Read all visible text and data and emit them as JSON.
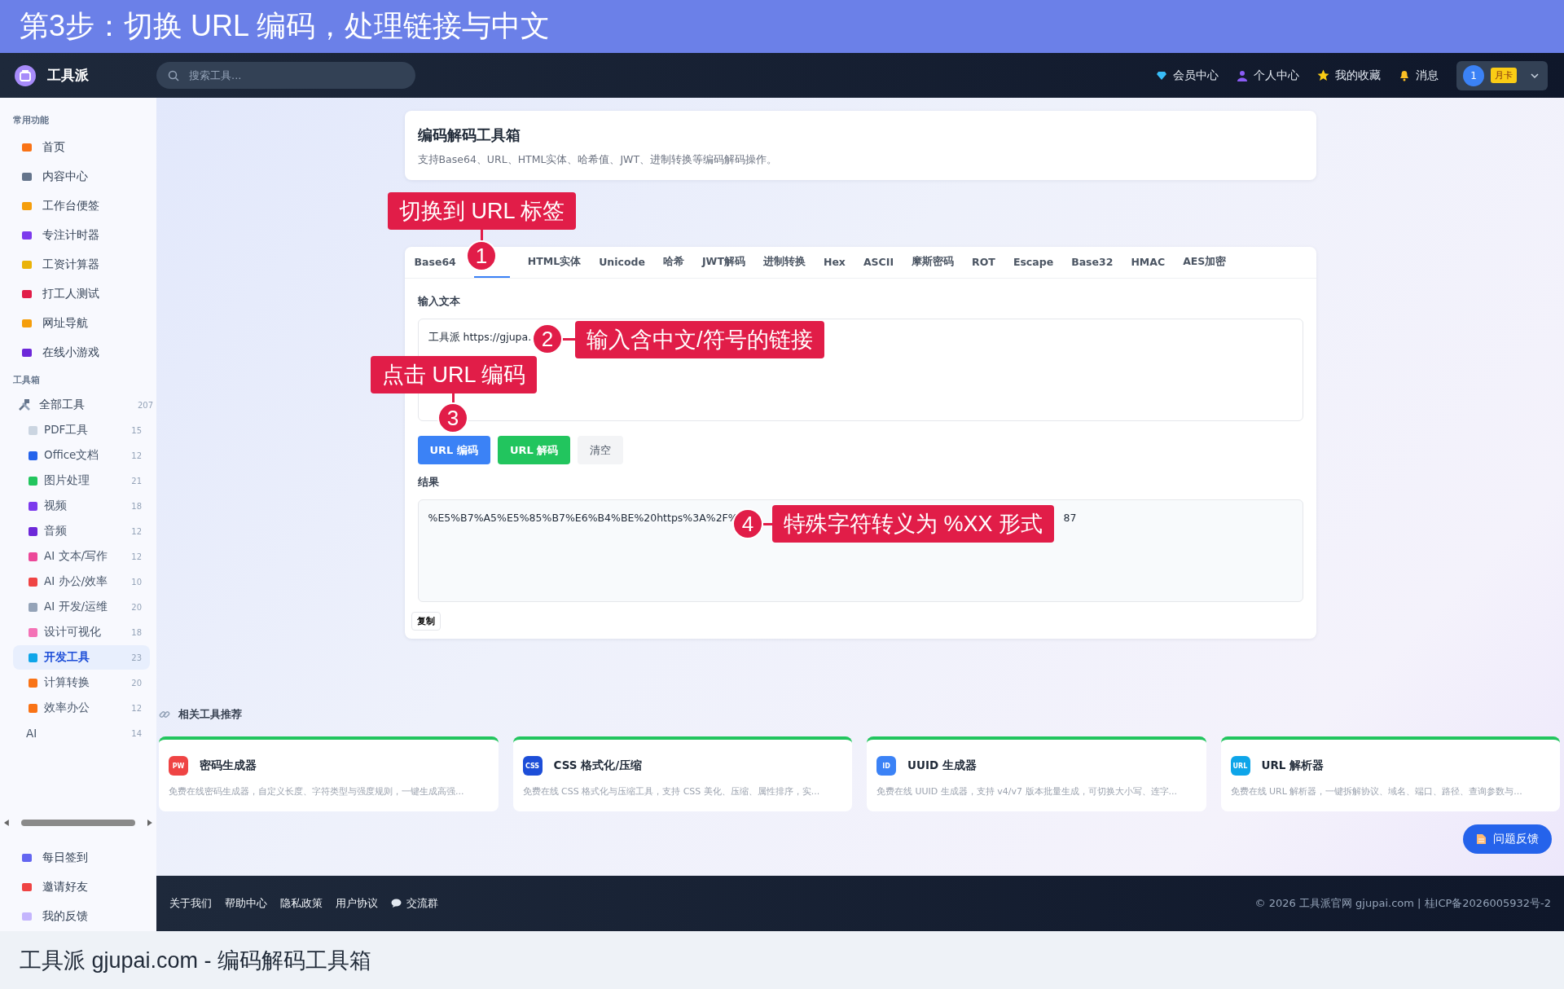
{
  "banner": {
    "title": "第3步：切换 URL 编码，处理链接与中文"
  },
  "header": {
    "logo": "工具派",
    "search": {
      "placeholder": "搜索工具..."
    },
    "nav": [
      {
        "label": "会员中心",
        "kind": "diamond"
      },
      {
        "label": "个人中心",
        "kind": "person"
      },
      {
        "label": "我的收藏",
        "kind": "star"
      },
      {
        "label": "消息",
        "kind": "bell"
      }
    ],
    "user": {
      "avatar": "1",
      "badge": "月卡"
    }
  },
  "sidebar": {
    "sections": [
      {
        "title": "常用功能",
        "items": [
          {
            "label": "首页"
          },
          {
            "label": "内容中心"
          },
          {
            "label": "工作台便签"
          },
          {
            "label": "专注计时器"
          },
          {
            "label": "工资计算器"
          },
          {
            "label": "打工人测试"
          },
          {
            "label": "网址导航"
          },
          {
            "label": "在线小游戏"
          }
        ]
      },
      {
        "title": "工具箱",
        "items": [
          {
            "label": "全部工具",
            "count": "207",
            "children": [
              {
                "label": "PDF工具",
                "count": "15",
                "kind": "icon",
                "selected": false
              },
              {
                "label": "Office文档",
                "count": "12",
                "kind": "icon",
                "selected": false
              },
              {
                "label": "图片处理",
                "count": "21",
                "kind": "icon",
                "selected": false
              },
              {
                "label": "视频",
                "count": "18",
                "kind": "icon",
                "selected": false
              },
              {
                "label": "音频",
                "count": "12",
                "kind": "icon",
                "selected": false
              },
              {
                "label": "AI 文本/写作",
                "count": "12",
                "kind": "icon",
                "selected": false
              },
              {
                "label": "AI 办公/效率",
                "count": "10",
                "kind": "icon",
                "selected": false
              },
              {
                "label": "AI 开发/运维",
                "count": "20",
                "kind": "icon",
                "selected": false
              },
              {
                "label": "设计可视化",
                "count": "18",
                "kind": "icon",
                "selected": false
              },
              {
                "label": "开发工具",
                "count": "23",
                "kind": "icon",
                "selected": true
              },
              {
                "label": "计算转换",
                "count": "20",
                "kind": "icon",
                "selected": false
              },
              {
                "label": "效率办公",
                "count": "12",
                "kind": "icon",
                "selected": false
              },
              {
                "label": "AI",
                "count": "14",
                "kind": "plain",
                "selected": false
              }
            ]
          }
        ]
      }
    ],
    "bottom_items": [
      {
        "label": "每日签到"
      },
      {
        "label": "邀请好友"
      },
      {
        "label": "我的反馈"
      }
    ]
  },
  "page": {
    "title": "编码解码工具箱",
    "subtitle": "支持Base64、URL、HTML实体、哈希值、JWT、进制转换等编码解码操作。"
  },
  "tabs": [
    {
      "label": "Base64",
      "selected": false
    },
    {
      "selected": true
    },
    {
      "label": "HTML实体",
      "selected": false
    },
    {
      "label": "Unicode",
      "selected": false
    },
    {
      "label": "哈希",
      "selected": false
    },
    {
      "label": "JWT解码",
      "selected": false
    },
    {
      "label": "进制转换",
      "selected": false
    },
    {
      "label": "Hex",
      "selected": false
    },
    {
      "label": "ASCII",
      "selected": false
    },
    {
      "label": "摩斯密码",
      "selected": false
    },
    {
      "label": "ROT",
      "selected": false
    },
    {
      "label": "Escape",
      "selected": false
    },
    {
      "label": "Base32",
      "selected": false
    },
    {
      "label": "HMAC",
      "selected": false
    },
    {
      "label": "AES加密",
      "selected": false
    }
  ],
  "input": {
    "label": "输入文本",
    "value": "工具派 https://gjupa."
  },
  "buttons": [
    {
      "label": "URL 编码",
      "kind": "primary"
    },
    {
      "label": "URL 解码",
      "kind": "success"
    },
    {
      "label": "清空",
      "kind": "plain"
    }
  ],
  "result": {
    "label": "结果",
    "text": "%E5%B7%A5%E5%85%B7%E6%B4%BE%20https%3A%2F%",
    "tail": "87",
    "copy": "复制"
  },
  "related": {
    "title": "相关工具推荐",
    "cards": [
      {
        "badge": "PW",
        "color": "#ef4444",
        "title": "密码生成器",
        "desc": "免费在线密码生成器，自定义长度、字符类型与强度规则，一键生成高强..."
      },
      {
        "badge": "CSS",
        "color": "#1d4ed8",
        "title": "CSS 格式化/压缩",
        "desc": "免费在线 CSS 格式化与压缩工具，支持 CSS 美化、压缩、属性排序，实..."
      },
      {
        "badge": "ID",
        "color": "#3b82f6",
        "title": "UUID 生成器",
        "desc": "免费在线 UUID 生成器，支持 v4/v7 版本批量生成，可切换大小写、连字..."
      },
      {
        "badge": "URL",
        "color": "#0ea5e9",
        "title": "URL 解析器",
        "desc": "免费在线 URL 解析器，一键拆解协议、域名、端口、路径、查询参数与..."
      }
    ]
  },
  "feedback": {
    "label": "问题反馈"
  },
  "footer": {
    "links": [
      {
        "label": "关于我们",
        "kind": "text"
      },
      {
        "label": "帮助中心",
        "kind": "text"
      },
      {
        "label": "隐私政策",
        "kind": "text"
      },
      {
        "label": "用户协议",
        "kind": "text"
      },
      {
        "label": "交流群",
        "kind": "chat"
      }
    ],
    "copyright": "© 2026 工具派官网 gjupai.com | 桂ICP备2026005932号-2"
  },
  "callouts": [
    {
      "number": "1",
      "text": "切换到 URL 标签",
      "kind": "above"
    },
    {
      "number": "2",
      "text": "输入含中文/符号的链接",
      "kind": "right"
    },
    {
      "number": "3",
      "text": "点击 URL 编码",
      "kind": "above"
    },
    {
      "number": "4",
      "text": "特殊字符转义为 %XX 形式",
      "kind": "right"
    }
  ],
  "caption": "工具派 gjupai.com - 编码解码工具箱"
}
